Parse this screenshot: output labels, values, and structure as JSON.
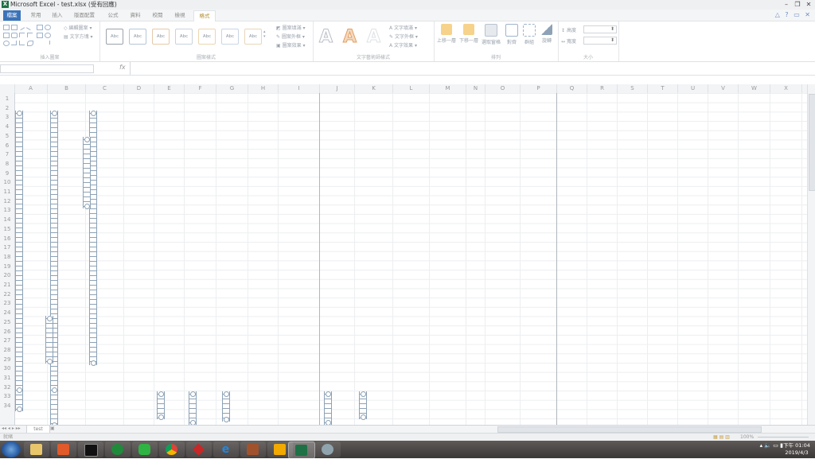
{
  "window": {
    "title": "Microsoft Excel - test.xlsx (受有回應)",
    "minimize": "–",
    "restore": "❐",
    "close": "✕"
  },
  "tabs": [
    {
      "label": "檔案",
      "kind": "file"
    },
    {
      "label": "常用",
      "kind": "normal"
    },
    {
      "label": "插入",
      "kind": "normal"
    },
    {
      "label": "版面配置",
      "kind": "normal"
    },
    {
      "label": "公式",
      "kind": "normal"
    },
    {
      "label": "資料",
      "kind": "normal"
    },
    {
      "label": "校閱",
      "kind": "normal"
    },
    {
      "label": "檢視",
      "kind": "normal"
    },
    {
      "label": "格式",
      "kind": "active"
    }
  ],
  "ribbon": {
    "insert_shapes": {
      "group_label": "插入圖案",
      "edit_shape": "編輯圖案",
      "text_box": "文字方塊"
    },
    "shape_styles": {
      "group_label": "圖案樣式",
      "swatch_label": "Abc",
      "fill": "圖案填滿",
      "outline": "圖案外框",
      "effects": "圖案效果"
    },
    "wordart": {
      "group_label": "文字藝術師樣式",
      "glyph": "A",
      "text_fill": "文字填滿",
      "text_outline": "文字外框",
      "text_effects": "文字效果"
    },
    "arrange": {
      "group_label": "排列",
      "bring_forward": "上移一層",
      "send_backward": "下移一層",
      "selection_pane": "選取窗格",
      "align": "對齊",
      "group": "群組",
      "rotate": "旋轉"
    },
    "size": {
      "group_label": "大小",
      "height_label": "高度",
      "width_label": "寬度"
    }
  },
  "formula_bar": {
    "fx": "fx"
  },
  "columns": [
    "A",
    "B",
    "C",
    "D",
    "E",
    "F",
    "G",
    "H",
    "I",
    "J",
    "K",
    "L",
    "M",
    "N",
    "O",
    "P",
    "Q",
    "R",
    "S",
    "T",
    "U",
    "V",
    "W",
    "X"
  ],
  "rows": [
    "1",
    "2",
    "3",
    "4",
    "5",
    "6",
    "7",
    "8",
    "9",
    "10",
    "11",
    "12",
    "13",
    "14",
    "15",
    "16",
    "17",
    "18",
    "19",
    "20",
    "21",
    "22",
    "23",
    "24",
    "25",
    "26",
    "27",
    "28",
    "29",
    "30",
    "31",
    "32",
    "33",
    "34"
  ],
  "sheet": {
    "tab": "test"
  },
  "status": {
    "ready": "就緒",
    "zoom": "100%"
  },
  "clock": {
    "time": "下午 01:04",
    "date": "2019/4/3"
  },
  "colors": {
    "file_tab": "#3b73b9",
    "excel_green": "#1e7145",
    "shape_outline": "#8da2b6"
  },
  "taskbar": [
    "windows-explorer",
    "media-app",
    "terminal",
    "green-eye-app",
    "line",
    "chrome",
    "red-diamond-app",
    "internet-explorer",
    "game-app",
    "outlook",
    "excel",
    "settings-app"
  ]
}
